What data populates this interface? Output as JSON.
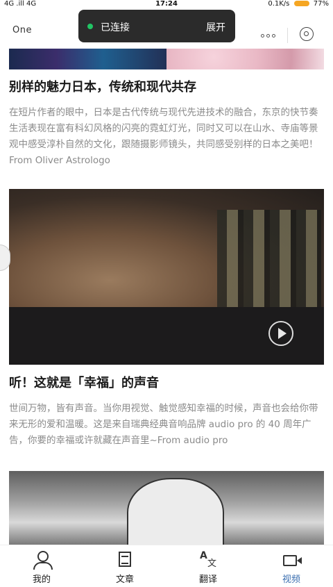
{
  "status_bar": {
    "network": "4G .ill 4G",
    "time": "17:24",
    "speed": "0.1K/s",
    "battery": "77%"
  },
  "header": {
    "logo": "One"
  },
  "toast": {
    "status": "已连接",
    "action": "展开",
    "dot_color": "#21c464"
  },
  "articles": [
    {
      "title": "别样的魅力日本，传统和现代共存",
      "description": "在短片作者的眼中，日本是古代传统与现代先进技术的融合，东京的快节奏生活表现在富有科幻风格的闪亮的霓虹灯光，同时又可以在山水、寺庙等景观中感受淳朴自然的文化，跟随摄影师镜头，共同感受别样的日本之美吧！From Oliver Astrologo"
    },
    {
      "title": "听！这就是「幸福」的声音",
      "description": "世间万物，皆有声音。当你用视觉、触觉感知幸福的时候，声音也会给你带来无形的爱和温暖。这是来自瑞典经典音响品牌 audio pro 的 40 周年广告，你要的幸福或许就藏在声音里~From audio pro"
    }
  ],
  "side_handle": "gu",
  "bottom_nav": [
    {
      "label": "我的",
      "icon": "person-icon"
    },
    {
      "label": "文章",
      "icon": "article-icon"
    },
    {
      "label": "翻译",
      "icon": "translate-icon"
    },
    {
      "label": "视频",
      "icon": "video-icon",
      "active": true
    }
  ],
  "colors": {
    "accent": "#3b6fb0",
    "toast_bg": "#2b2b2b"
  }
}
